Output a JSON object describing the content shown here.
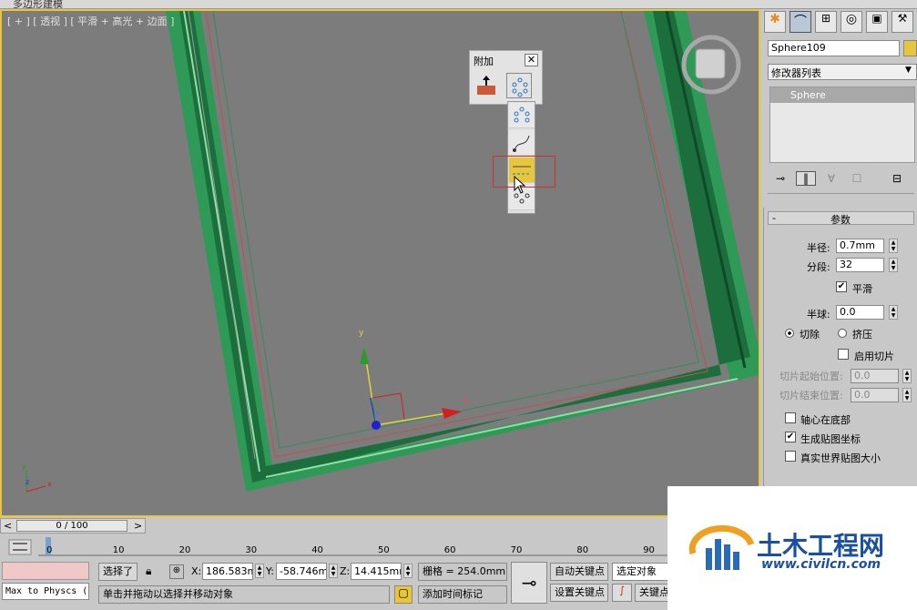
{
  "window": {
    "title": "多边形建模"
  },
  "viewport": {
    "label": "[ + ] [ 透视 ] [ 平滑 + 高光 + 边面 ]",
    "accent": "#e8c63b",
    "background": "#7c7c7c"
  },
  "attach_panel": {
    "title": "附加",
    "close": "✕"
  },
  "gizmo": {
    "x_label": "x",
    "y_label": "y",
    "z_label": "z"
  },
  "axis_tripod": {
    "x": "x",
    "y": "y",
    "z": "z"
  },
  "command_panel": {
    "object_name": "Sphere109",
    "modifier_list": "修改器列表",
    "stack_item": "Sphere",
    "rollout_title": "参数",
    "radius_label": "半径:",
    "radius_value": "0.7mm",
    "segments_label": "分段:",
    "segments_value": "32",
    "smooth_label": "平滑",
    "smooth_checked": true,
    "hemisphere_label": "半球:",
    "hemisphere_value": "0.0",
    "chop_label": "切除",
    "squash_label": "挤压",
    "enable_slice_label": "启用切片",
    "slice_from_label": "切片起始位置:",
    "slice_from_value": "0.0",
    "slice_to_label": "切片结束位置:",
    "slice_to_value": "0.0",
    "base_to_pivot_label": "轴心在底部",
    "gen_map_label": "生成贴图坐标",
    "gen_map_checked": true,
    "real_world_label": "真实世界贴图大小"
  },
  "timeline": {
    "position": "0 / 100",
    "prev": "<",
    "next": ">",
    "ticks": [
      "0",
      "10",
      "20",
      "30",
      "40",
      "50",
      "60",
      "70",
      "80",
      "90"
    ]
  },
  "status": {
    "maxscript": "Max to Physcs (",
    "selected": "选择了",
    "x_label": "X:",
    "x_value": "186.583mm",
    "y_label": "Y:",
    "y_value": "-58.746mm",
    "z_label": "Z:",
    "z_value": "14.415mm",
    "grid": "栅格 = 254.0mm",
    "auto_key": "自动关键点",
    "selected_obj": "选定对象",
    "prompt": "单击并拖动以选择并移动对象",
    "add_time_tag": "添加时间标记",
    "set_key": "设置关键点",
    "key_filters": "关键点"
  },
  "watermark": {
    "cn": "土木工程网",
    "url": "www.civilcn.com"
  }
}
